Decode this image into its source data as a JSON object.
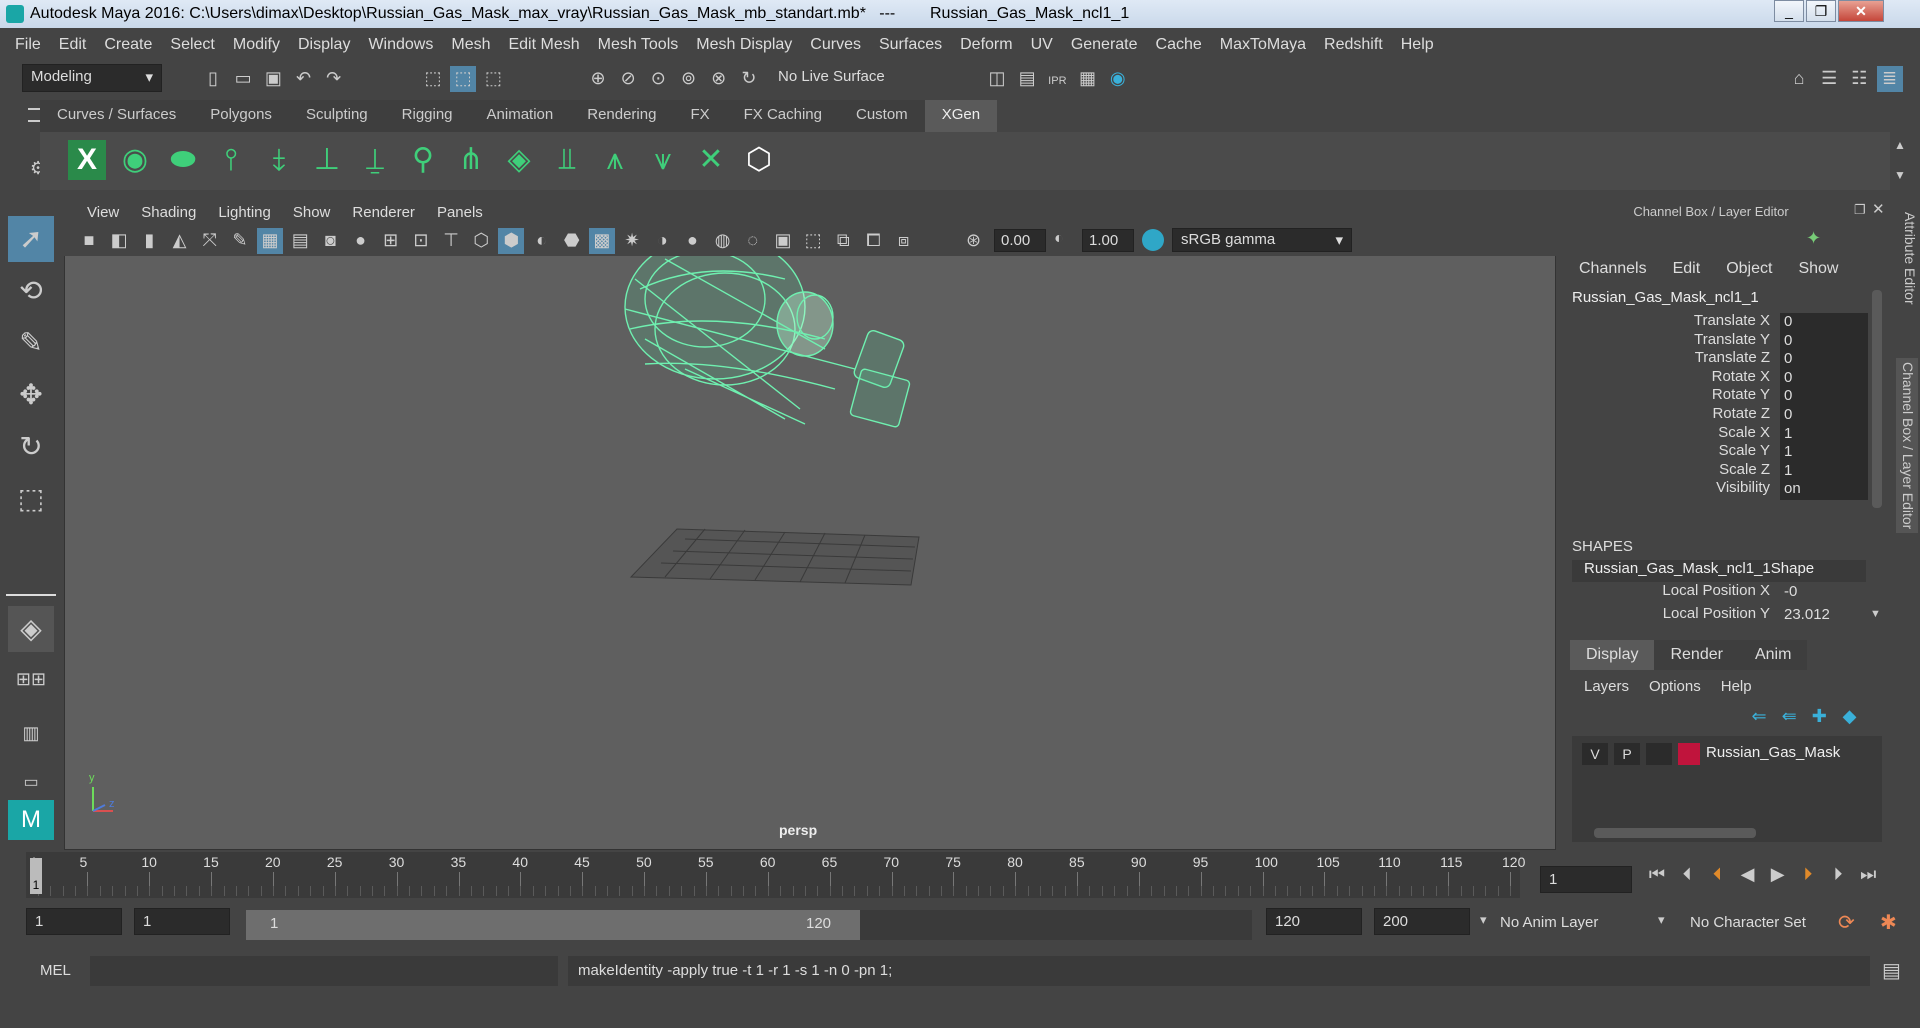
{
  "title_left": "Autodesk Maya 2016: C:\\Users\\dimax\\Desktop\\Russian_Gas_Mask_max_vray\\Russian_Gas_Mask_mb_standart.mb*",
  "title_sep": "---",
  "title_right": "Russian_Gas_Mask_ncl1_1",
  "menus": [
    "File",
    "Edit",
    "Create",
    "Select",
    "Modify",
    "Display",
    "Windows",
    "Mesh",
    "Edit Mesh",
    "Mesh Tools",
    "Mesh Display",
    "Curves",
    "Surfaces",
    "Deform",
    "UV",
    "Generate",
    "Cache",
    "MaxToMaya",
    "Redshift",
    "Help"
  ],
  "mode": "Modeling",
  "live_surface": "No Live Surface",
  "shelf_tabs": [
    "Curves / Surfaces",
    "Polygons",
    "Sculpting",
    "Rigging",
    "Animation",
    "Rendering",
    "FX",
    "FX Caching",
    "Custom",
    "XGen"
  ],
  "active_shelf_tab": "XGen",
  "viewport_menus": [
    "View",
    "Shading",
    "Lighting",
    "Show",
    "Renderer",
    "Panels"
  ],
  "exposure": "0.00",
  "gamma": "1.00",
  "color_space": "sRGB gamma",
  "camera": "persp",
  "channel_box": {
    "title": "Channel Box / Layer Editor",
    "menus": [
      "Channels",
      "Edit",
      "Object",
      "Show"
    ],
    "object": "Russian_Gas_Mask_ncl1_1",
    "channels": [
      {
        "name": "Translate X",
        "value": "0"
      },
      {
        "name": "Translate Y",
        "value": "0"
      },
      {
        "name": "Translate Z",
        "value": "0"
      },
      {
        "name": "Rotate X",
        "value": "0"
      },
      {
        "name": "Rotate Y",
        "value": "0"
      },
      {
        "name": "Rotate Z",
        "value": "0"
      },
      {
        "name": "Scale X",
        "value": "1"
      },
      {
        "name": "Scale Y",
        "value": "1"
      },
      {
        "name": "Scale Z",
        "value": "1"
      },
      {
        "name": "Visibility",
        "value": "on"
      }
    ],
    "shapes_label": "SHAPES",
    "shape_name": "Russian_Gas_Mask_ncl1_1Shape",
    "shape_channels": [
      {
        "name": "Local Position X",
        "value": "-0"
      },
      {
        "name": "Local Position Y",
        "value": "23.012"
      }
    ]
  },
  "layer_tabs": [
    "Display",
    "Render",
    "Anim"
  ],
  "layer_menus": [
    "Layers",
    "Options",
    "Help"
  ],
  "layer": {
    "v": "V",
    "p": "P",
    "name": "Russian_Gas_Mask",
    "color": "#c0143c"
  },
  "side_tabs": [
    "Attribute Editor",
    "Channel Box / Layer Editor"
  ],
  "timeline_ticks": [
    "1",
    "5",
    "10",
    "15",
    "20",
    "25",
    "30",
    "35",
    "40",
    "45",
    "50",
    "55",
    "60",
    "65",
    "70",
    "75",
    "80",
    "85",
    "90",
    "95",
    "100",
    "105",
    "110",
    "115",
    "120"
  ],
  "current_frame": "1",
  "range": {
    "start": "1",
    "inner_start": "1",
    "slider_start": "1",
    "slider_end": "120",
    "inner_end": "120",
    "end": "200"
  },
  "anim_layer": "No Anim Layer",
  "character_set": "No Character Set",
  "cmd_label": "MEL",
  "cmd_result": "makeIdentity -apply true -t 1 -r 1 -s 1 -n 0 -pn 1;"
}
